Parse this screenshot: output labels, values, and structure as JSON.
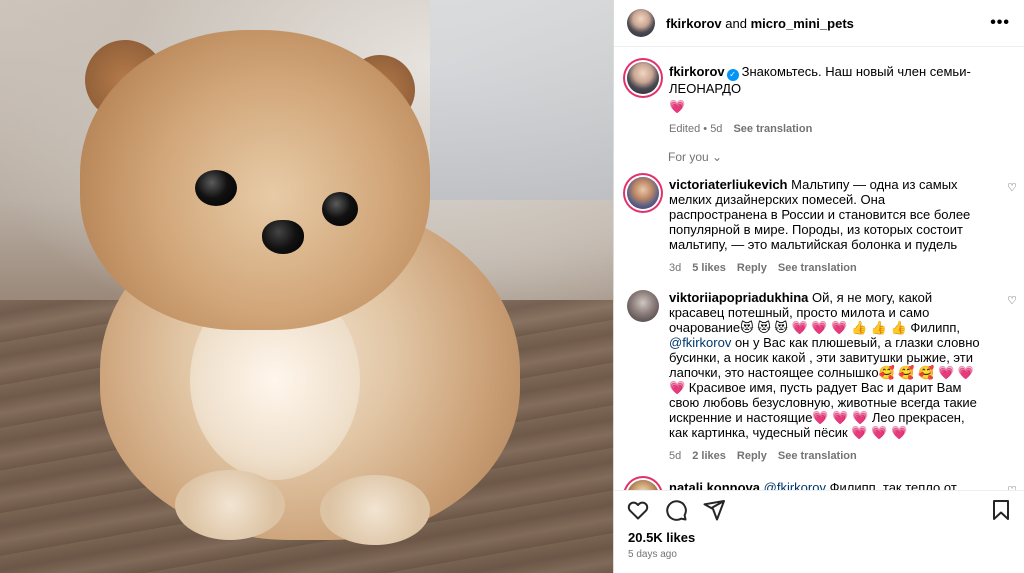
{
  "header": {
    "user": "fkirkorov",
    "joiner": " and ",
    "collab": "micro_mini_pets",
    "more_icon": "more-horizontal-icon"
  },
  "caption": {
    "user": "fkirkorov",
    "text": "Знакомьтесь. Наш новый член семьи- ЛЕОНАРДО",
    "emoji": "💗",
    "edited": "Edited",
    "dot": "•",
    "time": "5d",
    "see_translation": "See translation"
  },
  "for_you": "For you",
  "comments": [
    {
      "user": "victoriaterliukevich",
      "text": "Мальтипу — одна из самых мелких дизайнерских помесей. Она распространена в России и становится все более популярной в мире. Породы, из которых состоит мальтипу, — это мальтийская болонка и пудель",
      "time": "3d",
      "likes": "5 likes",
      "reply": "Reply",
      "see_translation": "See translation"
    },
    {
      "user": "viktoriiapopriadukhina",
      "text_a": "Ой, я не могу, какой красавец потешный, просто милота и само очарование😻 😻 😻 💗 💗 💗 👍 👍 👍 Филипп, ",
      "mention": "@fkirkorov",
      "text_b": " он у Вас как плюшевый, а глазки словно бусинки, а носик какой , эти завитушки рыжие, эти лапочки, это настоящее солнышко🥰 🥰 🥰 💗 💗 💗 Красивое имя, пусть радует Вас и дарит Вам свою любовь безусловную, животные всегда такие искренние и настоящие💗 💗 💗 Лео прекрасен, как картинка, чудесный пёсик 💗 💗 💗",
      "time": "5d",
      "likes": "2 likes",
      "reply": "Reply",
      "see_translation": "See translation"
    },
    {
      "user": "natali.konnova",
      "mention": "@fkirkorov",
      "text": " Филипп, так тепло от одной мысли, что это очаровательное создание будет радовать и умилять Вас каждый новый день 🥰 😻"
    }
  ],
  "actions": {
    "like_icon": "heart-icon",
    "comment_icon": "comment-icon",
    "share_icon": "share-icon",
    "save_icon": "bookmark-icon"
  },
  "likes": "20.5K likes",
  "date": "5 days ago"
}
